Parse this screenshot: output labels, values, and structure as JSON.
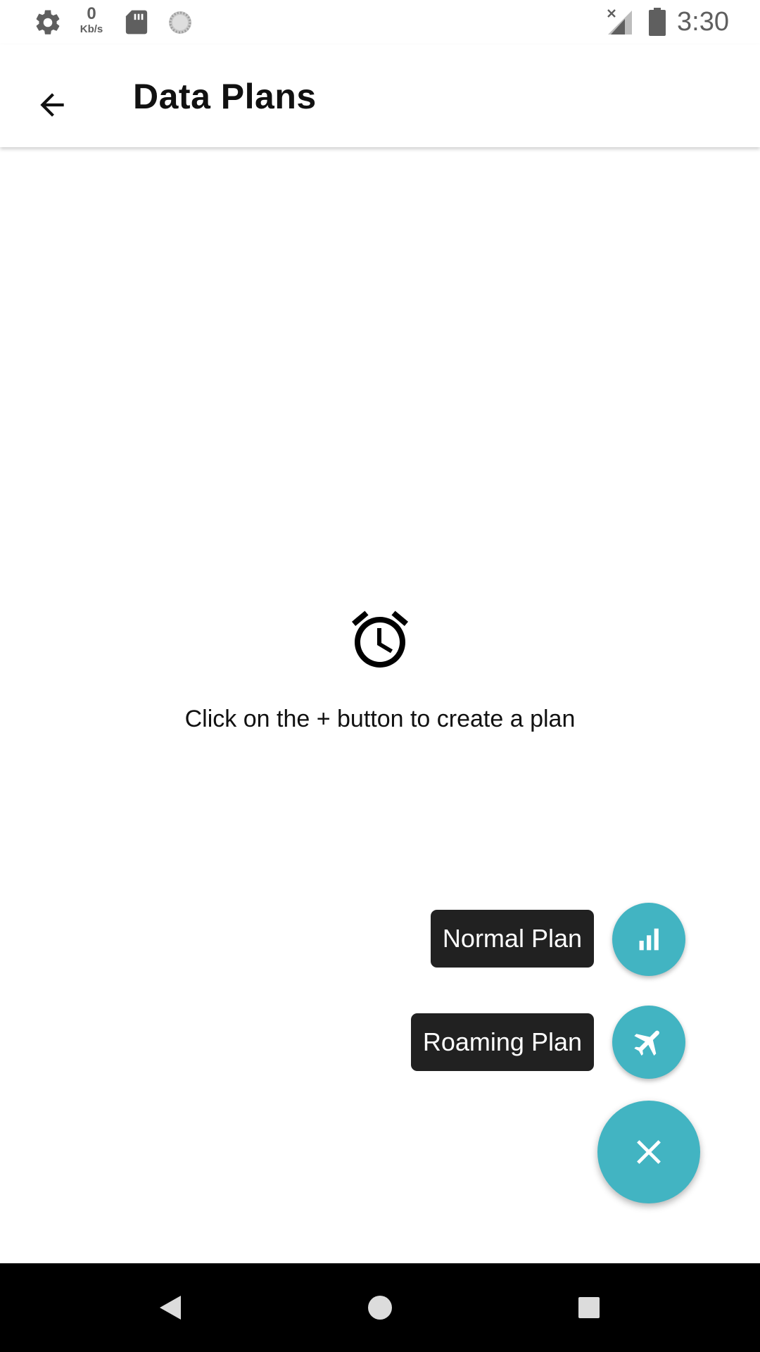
{
  "status_bar": {
    "icons": [
      "gear-icon",
      "sd-card-icon",
      "sync-icon",
      "signal-off-icon",
      "battery-icon"
    ],
    "net_speed_value": "0",
    "net_speed_unit": "Kb/s",
    "time": "3:30"
  },
  "app_bar": {
    "back_icon": "arrow-left-icon",
    "title": "Data Plans"
  },
  "empty_state": {
    "icon": "alarm-clock-icon",
    "message": "Click on the + button to create a plan"
  },
  "fab_menu": {
    "accent_color": "#42b4c2",
    "label_background": "#212121",
    "items": [
      {
        "label": "Normal Plan",
        "icon": "bar-chart-icon"
      },
      {
        "label": "Roaming Plan",
        "icon": "airplane-icon"
      }
    ],
    "main_icon": "close-icon"
  },
  "nav_bar": {
    "icons": [
      "nav-back-icon",
      "nav-home-icon",
      "nav-recents-icon"
    ]
  }
}
